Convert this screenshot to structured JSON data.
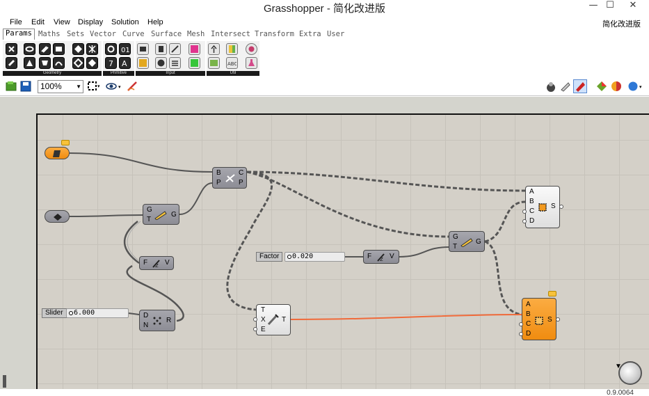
{
  "window": {
    "title": "Grasshopper - 简化改进版",
    "minimize": "—",
    "maximize": "☐",
    "close": "✕"
  },
  "menu": {
    "items": [
      "File",
      "Edit",
      "View",
      "Display",
      "Solution",
      "Help"
    ],
    "right_label": "简化改进版"
  },
  "tabs": [
    "Params",
    "Maths",
    "Sets",
    "Vector",
    "Curve",
    "Surface",
    "Mesh",
    "Intersect",
    "Transform",
    "Extra",
    "User"
  ],
  "active_tab": "Params",
  "ribbon": {
    "groups": [
      "Geometry",
      "Primitive",
      "Input",
      "Util"
    ]
  },
  "toolbar": {
    "zoom": "100%"
  },
  "canvas": {
    "sliders": [
      {
        "name": "Factor",
        "value": "0.020"
      },
      {
        "name": "Slider",
        "value": "6.000"
      }
    ],
    "components": {
      "cross_product": {
        "inputs": [
          "B",
          "P"
        ],
        "outputs": [
          "C",
          "P"
        ]
      },
      "gate_a": {
        "inputs": [
          "G",
          "T"
        ],
        "outputs": [
          "G"
        ]
      },
      "gate_b": {
        "inputs": [
          "G",
          "T"
        ],
        "outputs": [
          "G"
        ]
      },
      "func_a": {
        "inputs": [
          "F"
        ],
        "outputs": [
          "V"
        ]
      },
      "func_b": {
        "inputs": [
          "F"
        ],
        "outputs": [
          "V"
        ]
      },
      "random": {
        "inputs": [
          "D",
          "N"
        ],
        "outputs": [
          "R"
        ]
      },
      "transform": {
        "inputs": [
          "T",
          "X",
          "E"
        ],
        "outputs": [
          "T"
        ]
      },
      "surface_white": {
        "inputs": [
          "A",
          "B",
          "C",
          "D"
        ],
        "outputs": [
          "S"
        ]
      },
      "surface_orange": {
        "inputs": [
          "A",
          "B",
          "C",
          "D"
        ],
        "outputs": [
          "S"
        ]
      }
    }
  },
  "status": {
    "version": "0.9.0064"
  },
  "colors": {
    "orange": "#f39a1e",
    "wire": "#555555",
    "active_wire": "#f06a3a",
    "canvas": "#d4d0c8"
  }
}
